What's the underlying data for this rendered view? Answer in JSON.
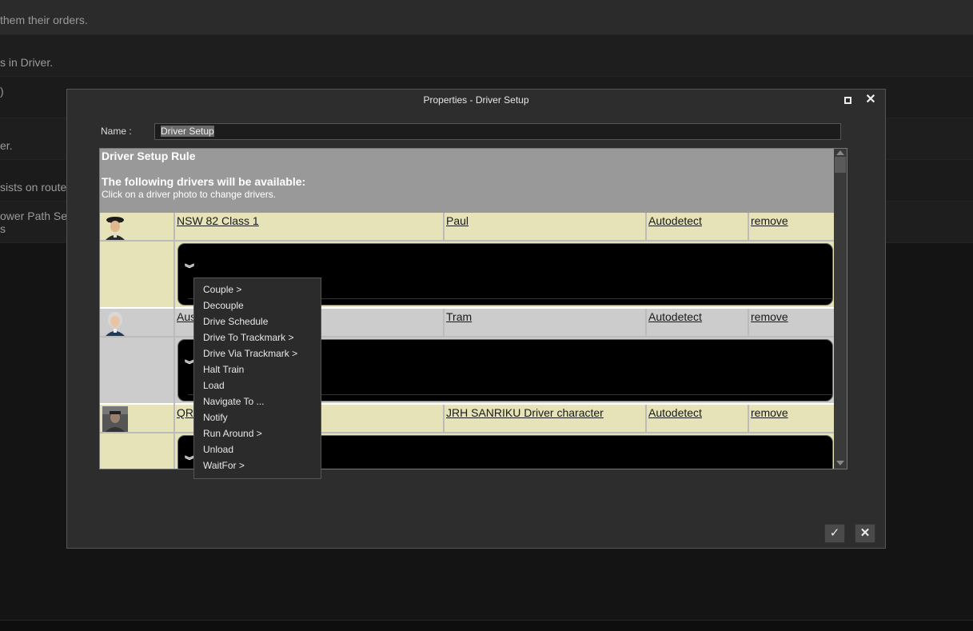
{
  "background": {
    "rows": [
      "them their orders.",
      "s in Driver.",
      ")",
      "er.",
      "sists on route",
      "ower Path Sele",
      "s"
    ]
  },
  "dialog": {
    "title": "Properties - Driver Setup",
    "name_label": "Name :",
    "name_value": "Driver Setup",
    "panel": {
      "title": "Driver Setup Rule",
      "subtitle": "The following drivers will be available:",
      "hint": "Click on a driver photo to change drivers."
    },
    "drivers": [
      {
        "train": "NSW 82 Class 1",
        "driver": "Paul",
        "mode": "Autodetect",
        "action": "remove",
        "row_color": "#e6e3b8"
      },
      {
        "train": "Aus",
        "driver": "Tram",
        "mode": "Autodetect",
        "action": "remove",
        "row_color": "#cccccc"
      },
      {
        "train": "QR",
        "driver": "JRH SANRIKU Driver character",
        "mode": "Autodetect",
        "action": "remove",
        "row_color": "#e6e3b8"
      }
    ],
    "ok_icon": "check-icon",
    "cancel_icon": "close-icon"
  },
  "context_menu": {
    "items": [
      "Couple >",
      "Decouple",
      "Drive Schedule",
      "Drive To Trackmark >",
      "Drive Via Trackmark >",
      "Halt Train",
      "Load",
      "Navigate To ...",
      "Notify",
      "Run Around >",
      "Unload",
      "WaitFor >"
    ]
  }
}
